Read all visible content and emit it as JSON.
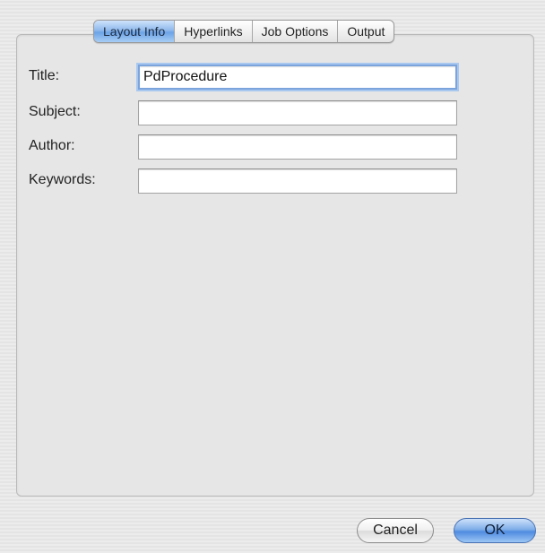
{
  "tabs": [
    {
      "label": "Layout Info",
      "selected": true
    },
    {
      "label": "Hyperlinks",
      "selected": false
    },
    {
      "label": "Job Options",
      "selected": false
    },
    {
      "label": "Output",
      "selected": false
    }
  ],
  "form": {
    "title_label": "Title:",
    "title_value": "PdProcedure",
    "subject_label": "Subject:",
    "subject_value": "",
    "author_label": "Author:",
    "author_value": "",
    "keywords_label": "Keywords:",
    "keywords_value": ""
  },
  "buttons": {
    "cancel_label": "Cancel",
    "ok_label": "OK"
  },
  "colors": {
    "selected_tab": "#8fb9ec",
    "default_button": "#4f8be0",
    "focus_ring": "#7ba4dd"
  }
}
